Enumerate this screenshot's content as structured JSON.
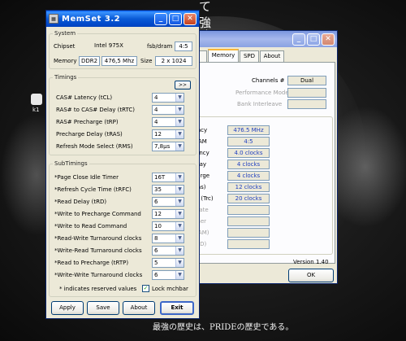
{
  "background": {
    "corner_text": "て 強く",
    "bottom_text": "最強の歴史は、PRIDEの歴史である。",
    "desktop_icon_label": "k1"
  },
  "back_window": {
    "tabs": [
      "rd",
      "Memory",
      "SPD",
      "About"
    ],
    "channels_label": "Channels #",
    "channels_value": "Dual",
    "left_trunc": "es",
    "perf_mode_label": "Performance Mode",
    "bank_interleave_label": "Bank Interleave",
    "rows": [
      {
        "label": "uency",
        "value": "476.5 MHz"
      },
      {
        "label": "DRAM",
        "value": "4:5"
      },
      {
        "label": "atency",
        "value": "4.0 clocks"
      },
      {
        "label": "Delay",
        "value": "4 clocks"
      },
      {
        "label": "charge",
        "value": "4 clocks"
      },
      {
        "label": "(Tras)",
        "value": "12 clocks"
      },
      {
        "label": "me (Trc)",
        "value": "20 clocks"
      },
      {
        "label": "d Rate",
        "value": ""
      },
      {
        "label": "Timer",
        "value": ""
      },
      {
        "label": "DRAM)",
        "value": ""
      },
      {
        "label": "(RCD)",
        "value": ""
      }
    ],
    "version": "Version 1.40",
    "ok_label": "OK"
  },
  "memset": {
    "title": "MemSet 3.2",
    "title_icon": "chip-icon",
    "system": {
      "legend": "System",
      "chipset_label": "Chipset",
      "chipset_value": "Intel 975X",
      "fsb_label": "fsb/dram",
      "fsb_value": "4:5",
      "memory_label": "Memory",
      "memory_type": "DDR2",
      "memory_speed": "476,5 Mhz",
      "size_label": "Size",
      "size_value": "2 x 1024"
    },
    "timings": {
      "legend": "Timings",
      "expand_label": ">>",
      "rows": [
        {
          "label": "CAS# Latency (tCL)",
          "value": "4"
        },
        {
          "label": "RAS# to CAS# Delay (tRTC)",
          "value": "4"
        },
        {
          "label": "RAS# Precharge (tRP)",
          "value": "4"
        },
        {
          "label": "Precharge Delay  (tRAS)",
          "value": "12"
        },
        {
          "label": "Refresh Mode Select (RMS)",
          "value": "7,8µs"
        }
      ]
    },
    "subtimings": {
      "legend": "SubTimings",
      "rows": [
        {
          "label": "*Page Close Idle Timer",
          "value": "16T"
        },
        {
          "label": "*Refresh Cycle Time (tRFC)",
          "value": "35"
        },
        {
          "label": "*Read Delay (tRD)",
          "value": "6"
        },
        {
          "label": "*Write to Precharge Command",
          "value": "12"
        },
        {
          "label": "*Write to Read Command",
          "value": "10"
        },
        {
          "label": "*Read-Write Turnaround clocks",
          "value": "8"
        },
        {
          "label": "*Write-Read Turnaround clocks",
          "value": "6"
        },
        {
          "label": "*Read to Precharge (tRTP)",
          "value": "5"
        },
        {
          "label": "*Write-Write Turnaround clocks",
          "value": "6"
        }
      ],
      "reserved_note": "* indicates reserved values",
      "lock_label": "Lock mchbar",
      "lock_checked": true
    },
    "buttons": {
      "apply": "Apply",
      "save": "Save",
      "about": "About",
      "exit": "Exit"
    }
  }
}
